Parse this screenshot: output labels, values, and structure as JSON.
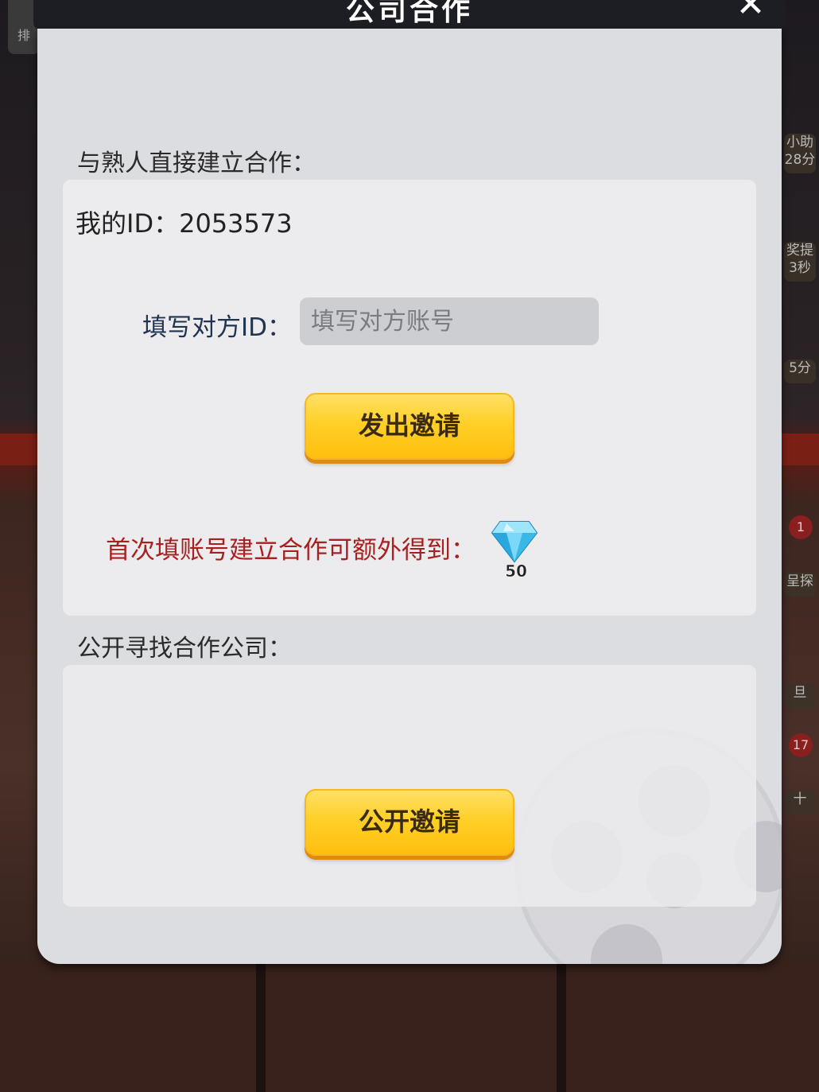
{
  "dialog": {
    "title": "公司合作",
    "close_symbol": "✕"
  },
  "direct_section": {
    "label": "与熟人直接建立合作：",
    "my_id_label": "我的ID：",
    "my_id_value": "2053573",
    "partner_id_label": "填写对方ID：",
    "partner_id_value": "",
    "partner_id_placeholder": "填写对方账号",
    "send_invite_label": "发出邀请",
    "bonus_text": "首次填账号建立合作可额外得到：",
    "bonus_icon": "diamond-icon",
    "bonus_amount": "50"
  },
  "public_section": {
    "label": "公开寻找合作公司：",
    "public_invite_label": "公开邀请"
  },
  "background": {
    "left_tab_text": "排",
    "side_badges": [
      {
        "line1": "小助",
        "line2": "28分"
      },
      {
        "line1": "奖提",
        "line2": "3秒"
      },
      {
        "line1": "5分",
        "line2": ""
      },
      {
        "line1": "呈探",
        "line2": ""
      },
      {
        "line1": "旦",
        "line2": ""
      },
      {
        "line1": "十",
        "line2": ""
      }
    ],
    "notification_counts": [
      "1",
      "17"
    ]
  },
  "colors": {
    "accent_button": "#ffd028",
    "bonus_text": "#a82020",
    "title_bar": "#1d1e24"
  }
}
